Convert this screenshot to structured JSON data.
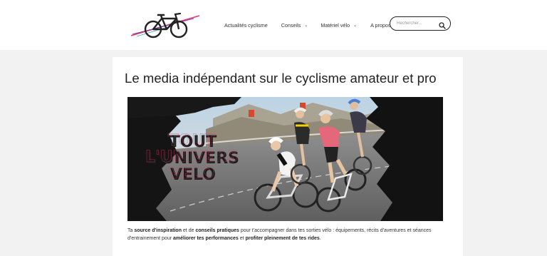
{
  "header": {
    "logo_icon": "bicycle-icon",
    "nav": [
      {
        "label": "Actualités cyclisme",
        "has_dropdown": false
      },
      {
        "label": "Conseils",
        "has_dropdown": true
      },
      {
        "label": "Matériel vélo",
        "has_dropdown": true
      },
      {
        "label": "A propos",
        "has_dropdown": false
      }
    ],
    "search": {
      "placeholder": "Rechercher...",
      "value": "",
      "icon": "search-icon"
    }
  },
  "main": {
    "title": "Le media indépendant sur le cyclisme amateur et pro",
    "hero": {
      "overlay_lines": [
        "TOUT",
        "L'UNIVERS",
        "VELO"
      ]
    },
    "description": {
      "t1": "Ta ",
      "b1": "source d'inspiration",
      "t2": " et de ",
      "b2": "conseils pratiques",
      "t3": " pour t'accompagner dans tes sorties vélo : équipements, récits d'aventures et séances d'entrainement pour ",
      "b3": "améliorer tes performances",
      "t4": " et ",
      "b4": "profiter pleinement de tes rides",
      "t5": "."
    }
  },
  "colors": {
    "accent_pink": "#e83a6b",
    "accent_purple": "#6a3fb6",
    "overlay_text": "#1b1b1b"
  }
}
